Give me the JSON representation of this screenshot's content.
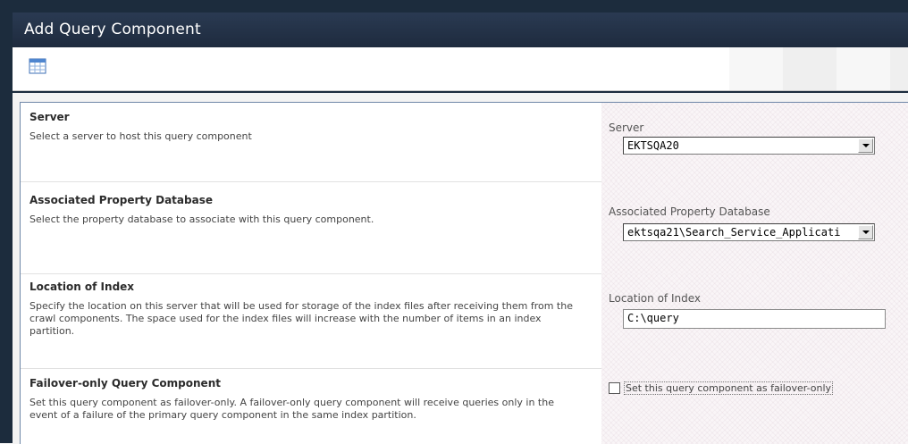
{
  "window": {
    "title": "Add Query Component"
  },
  "toolbar": {
    "icon": "table-grid-icon"
  },
  "sections": {
    "server": {
      "title": "Server",
      "description": "Select a server to host this query component",
      "field_label": "Server",
      "selected": "EKTSQA20"
    },
    "property_db": {
      "title": "Associated Property Database",
      "description": "Select the property database to associate with this query component.",
      "field_label": "Associated Property Database",
      "selected": "ektsqa21\\Search_Service_Applicati"
    },
    "index_location": {
      "title": "Location of Index",
      "description": "Specify the location on this server that will be used for storage of the index files after receiving them from the crawl components. The space used for the index files will increase with the number of items in an index partition.",
      "field_label": "Location of Index",
      "value": "C:\\query"
    },
    "failover": {
      "title": "Failover-only Query Component",
      "description": "Set this query component as failover-only. A failover-only query component will receive queries only in the event of a failure of the primary query component in the same index partition.",
      "checkbox_label": "Set this query component as failover-only",
      "checked": false
    }
  }
}
